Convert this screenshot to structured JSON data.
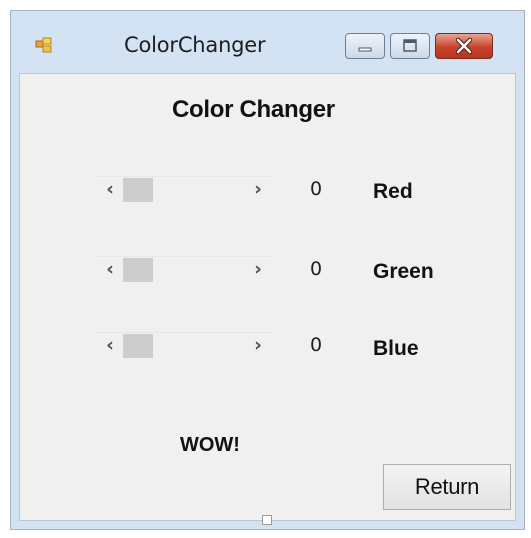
{
  "window": {
    "title": "ColorChanger",
    "controls": {
      "minimize_icon": "minimize-icon",
      "maximize_icon": "maximize-icon",
      "close_icon": "close-icon"
    }
  },
  "form": {
    "heading": "Color Changer",
    "sliders": [
      {
        "value": "0",
        "label": "Red"
      },
      {
        "value": "0",
        "label": "Green"
      },
      {
        "value": "0",
        "label": "Blue"
      }
    ],
    "message": "WOW!",
    "return_label": "Return",
    "scroll_left_glyph": "‹",
    "scroll_right_glyph": "›"
  },
  "colors": {
    "titlebar": "#d3e3f3",
    "client_bg": "#f0f0f0",
    "close_button": "#c8432a",
    "scroll_thumb": "#cdcdcd"
  }
}
